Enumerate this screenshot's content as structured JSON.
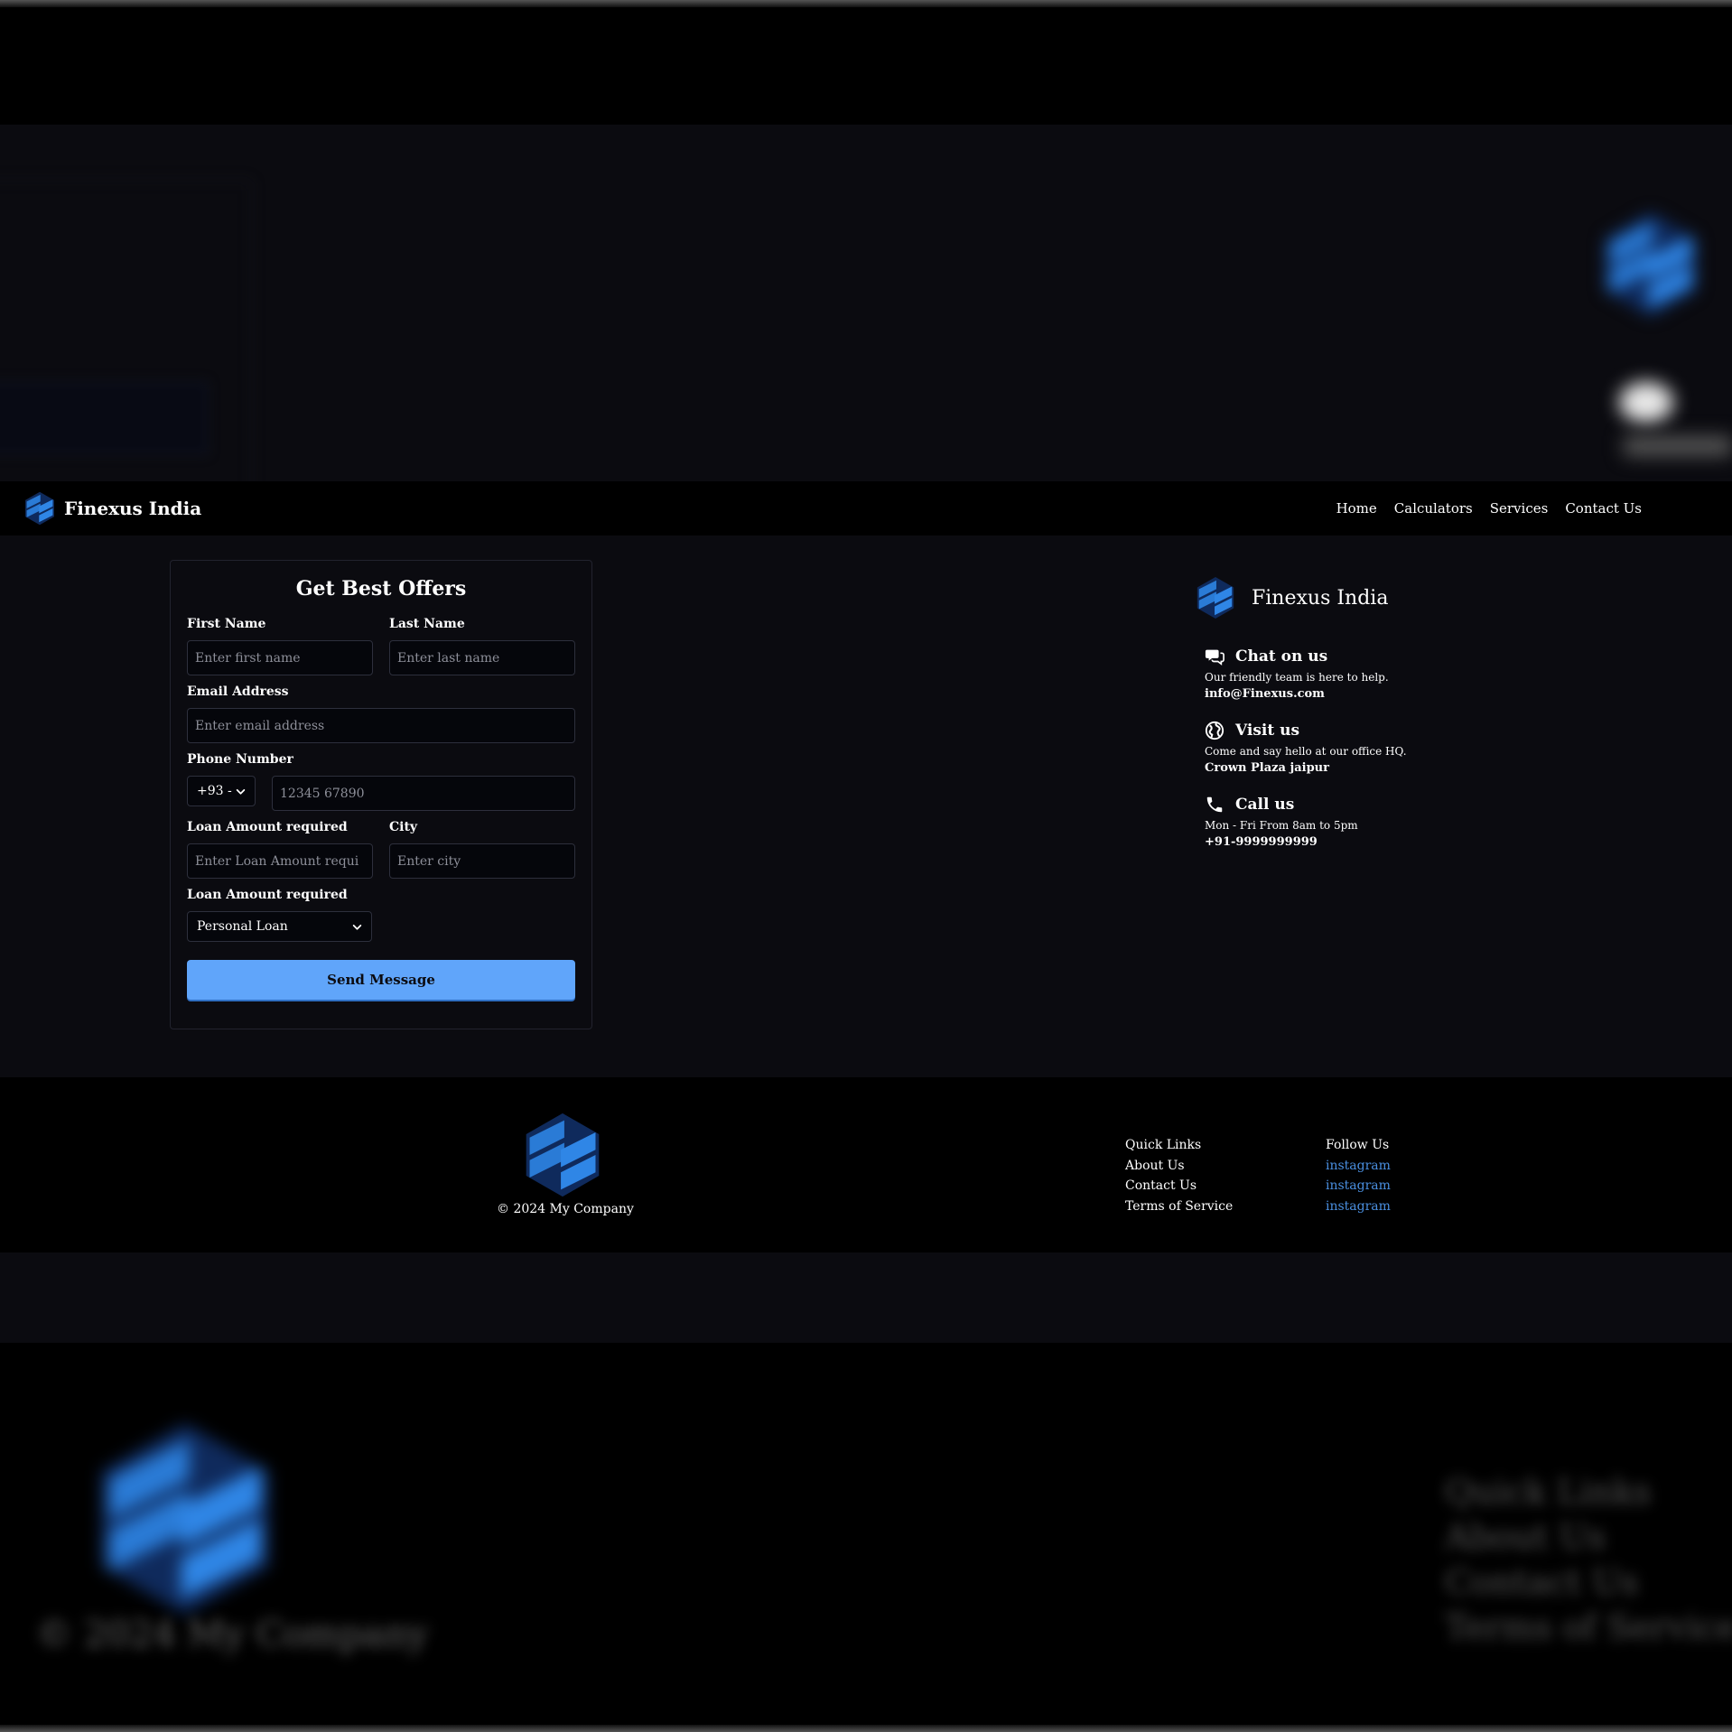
{
  "navbar": {
    "brand": "Finexus India",
    "links": [
      "Home",
      "Calculators",
      "Services",
      "Contact Us"
    ]
  },
  "form": {
    "title": "Get Best Offers",
    "first_name": {
      "label": "First Name",
      "placeholder": "Enter first name"
    },
    "last_name": {
      "label": "Last Name",
      "placeholder": "Enter last name"
    },
    "email": {
      "label": "Email Address",
      "placeholder": "Enter email address"
    },
    "phone": {
      "label": "Phone Number",
      "country_code": "+93 -",
      "placeholder": "12345 67890"
    },
    "loan_amount": {
      "label": "Loan Amount required",
      "placeholder": "Enter Loan Amount requi"
    },
    "city": {
      "label": "City",
      "placeholder": "Enter city"
    },
    "loan_type": {
      "label": "Loan Amount required",
      "selected": "Personal Loan"
    },
    "submit": "Send Message"
  },
  "contact": {
    "brand": "Finexus India",
    "chat": {
      "title": "Chat on us",
      "desc": "Our friendly team is here to help.",
      "value": "info@Finexus.com"
    },
    "visit": {
      "title": "Visit us",
      "desc": "Come and say hello at our office HQ.",
      "value": "Crown Plaza jaipur"
    },
    "call": {
      "title": "Call us",
      "desc": "Mon - Fri From 8am to 5pm",
      "value": "+91-9999999999"
    }
  },
  "footer": {
    "copyright": "© 2024 My Company",
    "quick_links": {
      "heading": "Quick Links",
      "items": [
        "About Us",
        "Contact Us",
        "Terms of Service"
      ]
    },
    "follow_us": {
      "heading": "Follow Us",
      "items": [
        "instagram",
        "instagram",
        "instagram"
      ]
    }
  },
  "colors": {
    "accent": "#60a5fa",
    "logo_blue": "#2a7bd6",
    "logo_dark": "#0f2a5c",
    "link_blue": "#4a8fe0",
    "page_bg": "#0b0b10",
    "footer_bg": "#000000"
  },
  "icons": [
    "finexus-logo",
    "chat-icon",
    "globe-icon",
    "phone-icon",
    "chevron-down-icon"
  ]
}
